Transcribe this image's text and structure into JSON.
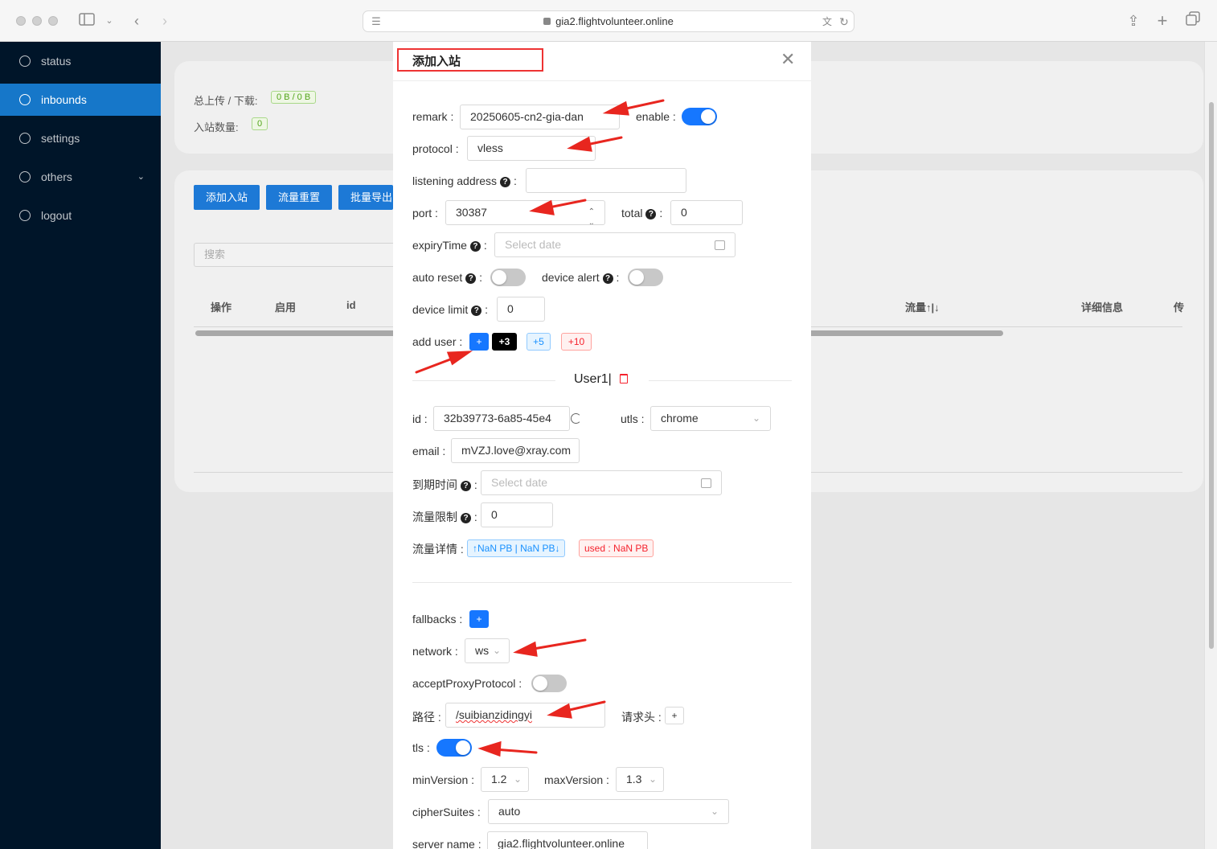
{
  "browser": {
    "url": "gia2.flightvolunteer.online"
  },
  "sidebar": {
    "items": [
      {
        "label": "status",
        "icon": "dashboard-icon"
      },
      {
        "label": "inbounds",
        "icon": "user-icon",
        "active": true
      },
      {
        "label": "settings",
        "icon": "gear-icon"
      },
      {
        "label": "others",
        "icon": "link-icon",
        "has_children": true
      },
      {
        "label": "logout",
        "icon": "logout-icon"
      }
    ]
  },
  "background": {
    "total_label": "总上传 / 下载:",
    "total_value": "0 B / 0 B",
    "count_label": "入站数量:",
    "count_value": "0",
    "buttons": [
      "添加入站",
      "流量重置",
      "批量导出"
    ],
    "search_placeholder": "搜索",
    "columns": [
      "操作",
      "启用",
      "id",
      "流量↑|↓",
      "详细信息",
      "传"
    ]
  },
  "modal": {
    "title": "添加入站",
    "remark_label": "remark",
    "remark_value": "20250605-cn2-gia-dan",
    "enable_label": "enable",
    "enable_on": true,
    "protocol_label": "protocol",
    "protocol_value": "vless",
    "listen_label": "listening address",
    "listen_value": "",
    "port_label": "port",
    "port_value": "30387",
    "total_label": "total",
    "total_value": "0",
    "expiry_label": "expiryTime",
    "expiry_placeholder": "Select date",
    "autoreset_label": "auto reset",
    "autoreset_on": false,
    "devalert_label": "device alert",
    "devalert_on": false,
    "devlimit_label": "device limit",
    "devlimit_value": "0",
    "adduser_label": "add user",
    "adduser_buttons": [
      "+",
      "+3",
      "+5",
      "+10"
    ],
    "user_title": "User1|",
    "id_label": "id",
    "id_value": "32b39773-6a85-45e4",
    "utls_label": "utls",
    "utls_value": "chrome",
    "email_label": "email",
    "email_value": "mVZJ.love@xray.com",
    "expire_cn_label": "到期时间",
    "expire_cn_placeholder": "Select date",
    "traffic_limit_label": "流量限制",
    "traffic_limit_value": "0",
    "traffic_detail_label": "流量详情",
    "traffic_detail_updown": "↑NaN PB | NaN PB↓",
    "traffic_detail_used": "used : NaN PB",
    "fallbacks_label": "fallbacks",
    "fallbacks_button": "+",
    "network_label": "network",
    "network_value": "ws",
    "proxyproto_label": "acceptProxyProtocol",
    "proxyproto_on": false,
    "path_label": "路径",
    "path_value": "/suibianzidingyi",
    "header_label": "请求头",
    "header_button": "+",
    "tls_label": "tls",
    "tls_on": true,
    "minver_label": "minVersion",
    "minver_value": "1.2",
    "maxver_label": "maxVersion",
    "maxver_value": "1.3",
    "cipher_label": "cipherSuites",
    "cipher_value": "auto",
    "servername_label": "server name",
    "servername_value": "gia2.flightvolunteer.online"
  },
  "colors": {
    "sidebar_bg": "#001529",
    "active_item": "#1677c9",
    "primary": "#1677ff",
    "annotation_red": "#e8261f"
  }
}
